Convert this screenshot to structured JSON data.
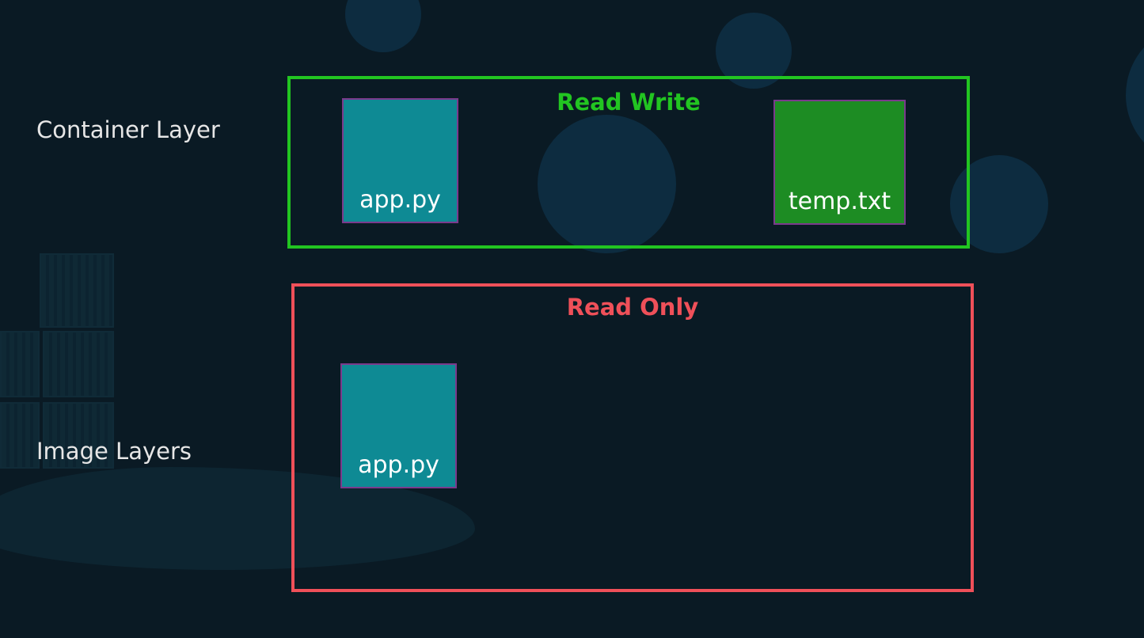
{
  "labels": {
    "container_layer": "Container Layer",
    "image_layers": "Image Layers"
  },
  "read_write_box": {
    "title": "Read Write",
    "color": "#22c521",
    "files": [
      "app.py",
      "temp.txt"
    ]
  },
  "read_only_box": {
    "title": "Read Only",
    "color": "#ef5059",
    "files": [
      "app.py"
    ]
  },
  "colors": {
    "background": "#0a1a24",
    "file_teal": "#0e8a94",
    "file_green": "#1d8c23",
    "file_border": "#7b3a8c"
  }
}
